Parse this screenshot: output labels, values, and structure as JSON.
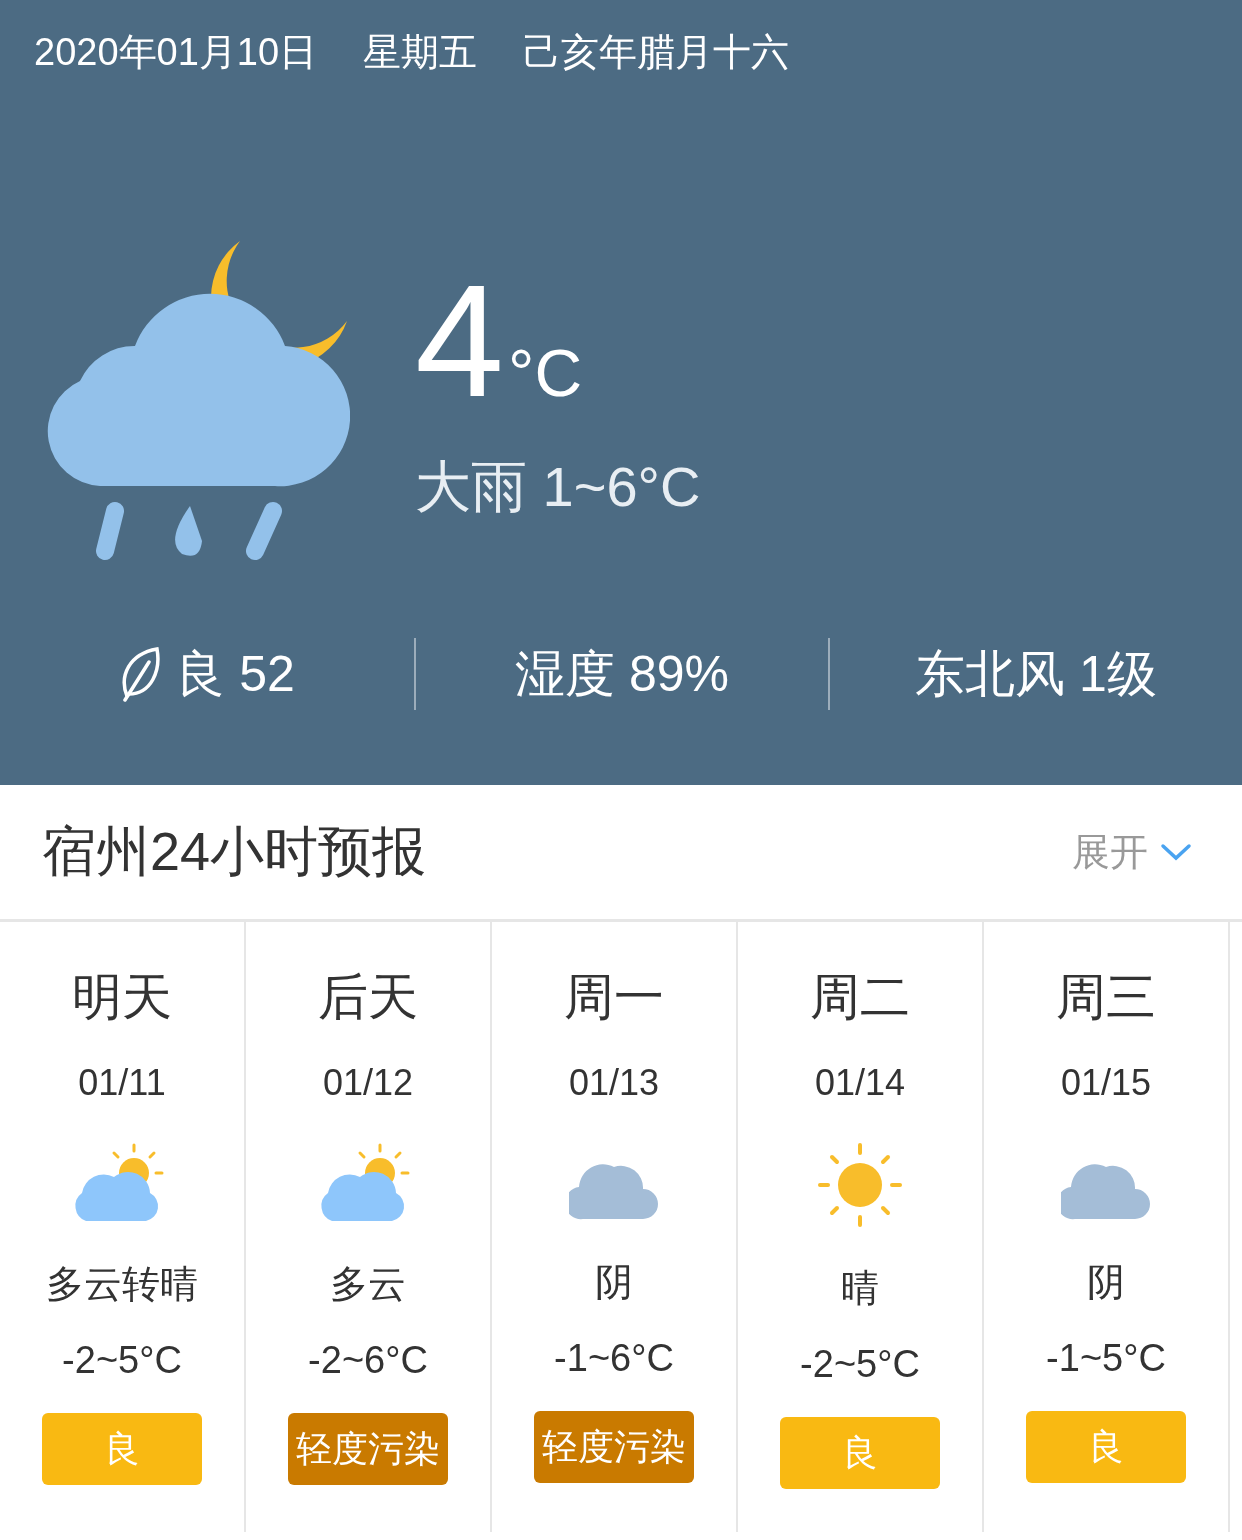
{
  "date": "2020年01月10日",
  "weekday": "星期五",
  "lunar": "己亥年腊月十六",
  "current": {
    "kind": "rain-night",
    "temp": "4",
    "unit": "°C",
    "summary": "大雨 1~6°C"
  },
  "stats": [
    {
      "kind": "air",
      "text": "良 52"
    },
    {
      "kind": "plain",
      "text": "湿度 89%"
    },
    {
      "kind": "plain",
      "text": "东北风 1级"
    }
  ],
  "forecast_header": {
    "title": "宿州24小时预报",
    "toggle": "展开"
  },
  "days": [
    {
      "day": "明天",
      "date": "01/11",
      "kind": "partly-sunny",
      "condition": "多云转晴",
      "temp": "-2~5°C",
      "aqi": "良",
      "color": "#f9b912"
    },
    {
      "day": "后天",
      "date": "01/12",
      "kind": "partly-sunny",
      "condition": "多云",
      "temp": "-2~6°C",
      "aqi": "轻度污染",
      "color": "#c97a00"
    },
    {
      "day": "周一",
      "date": "01/13",
      "kind": "cloudy",
      "condition": "阴",
      "temp": "-1~6°C",
      "aqi": "轻度污染",
      "color": "#c97a00"
    },
    {
      "day": "周二",
      "date": "01/14",
      "kind": "sunny",
      "condition": "晴",
      "temp": "-2~5°C",
      "aqi": "良",
      "color": "#f9b912"
    },
    {
      "day": "周三",
      "date": "01/15",
      "kind": "cloudy",
      "condition": "阴",
      "temp": "-1~5°C",
      "aqi": "良",
      "color": "#f9b912"
    }
  ]
}
